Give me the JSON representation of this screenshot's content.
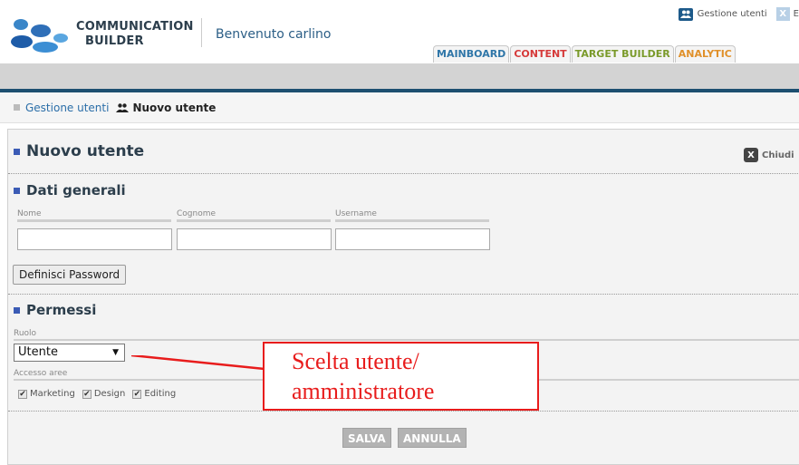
{
  "header": {
    "logo_line1": "COMMUNICATION",
    "logo_line2": "BUILDER",
    "welcome": "Benvenuto carlino",
    "user_mgmt": "Gestione utenti",
    "top_right_extra": "E",
    "tabs": [
      {
        "label": "MAINBOARD",
        "color": "#2f76a8",
        "accent": "#2f76a8"
      },
      {
        "label": "CONTENT",
        "color": "#d63a3a",
        "accent": "#d63a3a"
      },
      {
        "label": "TARGET BUILDER",
        "color": "#7a9a2a",
        "accent": "#7a9a2a"
      },
      {
        "label": "ANALYTIC",
        "color": "#e0902a",
        "accent": "#e0902a"
      }
    ]
  },
  "breadcrumb": {
    "link": "Gestione utenti",
    "current": "Nuovo utente"
  },
  "panel": {
    "title": "Nuovo utente",
    "close_label": "Chiudi",
    "section_general": "Dati generali",
    "fields": {
      "nome": "Nome",
      "cognome": "Cognome",
      "username": "Username"
    },
    "define_password": "Definisci Password",
    "section_permissions": "Permessi",
    "ruolo_label": "Ruolo",
    "ruolo_value": "Utente",
    "accesso_label": "Accesso aree",
    "areas": [
      "Marketing",
      "Design",
      "Editing"
    ],
    "save": "SALVA",
    "cancel": "ANNULLA"
  },
  "annotation": {
    "line1": "Scelta utente/",
    "line2": "amministratore",
    "color": "#e81c1c"
  }
}
